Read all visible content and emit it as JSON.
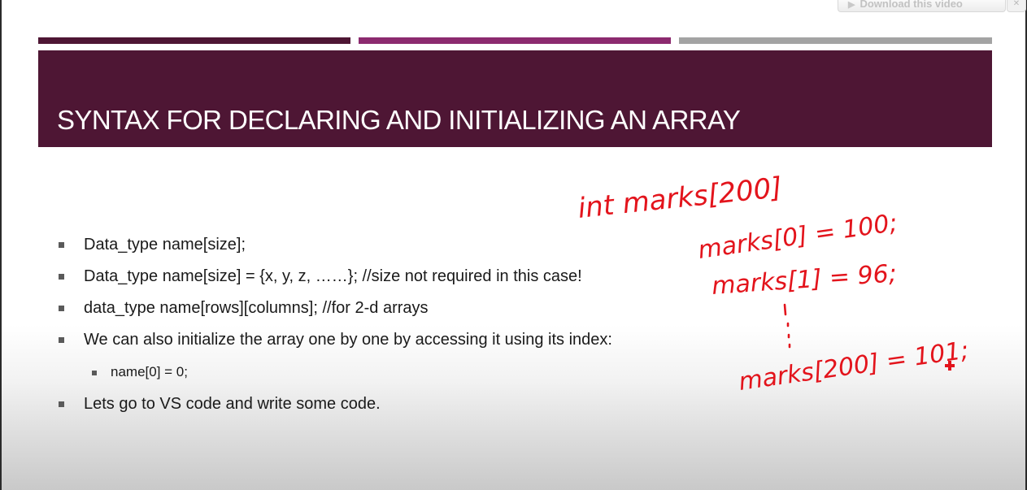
{
  "player": {
    "download_label": "Download this video",
    "close_glyph": "✕"
  },
  "slide": {
    "title": "SYNTAX FOR DECLARING AND INITIALIZING AN ARRAY",
    "colors": {
      "banner": "#4e1634",
      "accent_magenta": "#8c2a6f",
      "accent_gray": "#a3a3a3",
      "annotation_ink": "#e3141c"
    },
    "bullets": [
      {
        "level": 1,
        "text": "Data_type name[size];"
      },
      {
        "level": 1,
        "text": "Data_type name[size] = {x, y, z, ……}; //size not required in this case!"
      },
      {
        "level": 1,
        "text": "data_type name[rows][columns];  //for 2-d arrays"
      },
      {
        "level": 1,
        "text": "We can also initialize the array one by one by accessing it using its index:"
      },
      {
        "level": 2,
        "text": "name[0] = 0;"
      },
      {
        "level": 1,
        "text": "Lets go to VS code and write some code."
      }
    ]
  },
  "annotations": {
    "line1": "int marks[200]",
    "line2": "marks[0] = 100;",
    "line3": "marks[1] = 96;",
    "line4": "marks[200] = 101;"
  }
}
